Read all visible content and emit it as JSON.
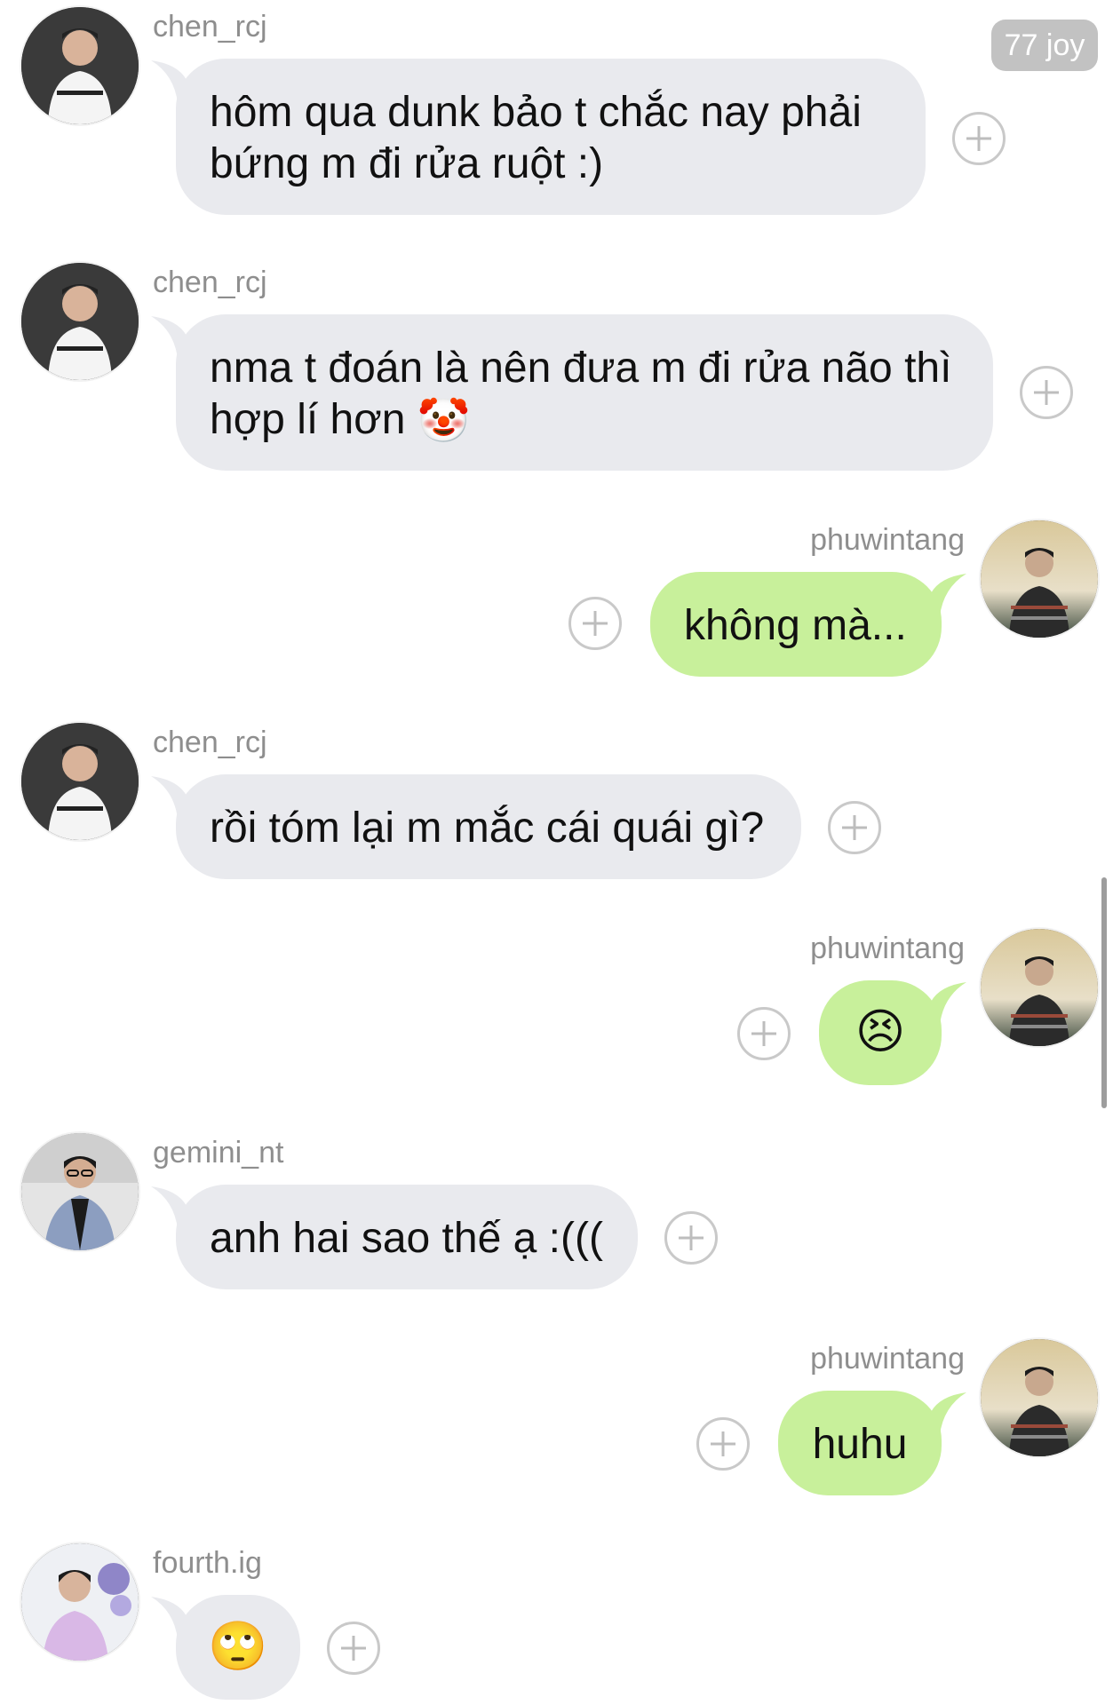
{
  "badge": {
    "label": "77 joy"
  },
  "messages": [
    {
      "sender": "chen_rcj",
      "side": "in",
      "text": "hôm qua dunk bảo t chắc nay phải bứng m đi rửa ruột :)"
    },
    {
      "sender": "chen_rcj",
      "side": "in",
      "text": "nma t đoán là nên đưa m đi rửa não thì hợp lí hơn",
      "emoji": "🤡"
    },
    {
      "sender": "phuwintang",
      "side": "out",
      "text": "không mà..."
    },
    {
      "sender": "chen_rcj",
      "side": "in",
      "text": "rồi tóm lại m mắc cái quái gì?"
    },
    {
      "sender": "phuwintang",
      "side": "out",
      "emoji": "😣"
    },
    {
      "sender": "gemini_nt",
      "side": "in",
      "text": "anh hai sao thế ạ :((("
    },
    {
      "sender": "phuwintang",
      "side": "out",
      "text": "huhu"
    },
    {
      "sender": "fourth.ig",
      "side": "in",
      "emoji": "🙄"
    }
  ],
  "icons": {
    "add": "plus-circle-icon",
    "avatar": "user-avatar"
  },
  "colors": {
    "incoming_bubble": "#e9eaee",
    "outgoing_bubble": "#c8f09b",
    "name_text": "#8e8e8e",
    "badge_bg": "#c2c2c2"
  }
}
